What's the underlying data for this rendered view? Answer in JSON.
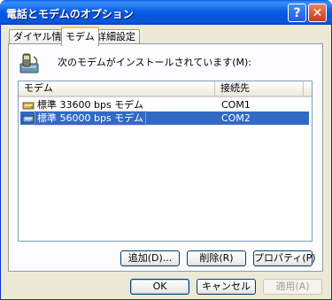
{
  "window": {
    "title": "電話とモデムのオプション",
    "help_glyph": "?",
    "close_glyph": "✕"
  },
  "tabs": [
    {
      "label": "ダイヤル情報",
      "active": false
    },
    {
      "label": "モデム",
      "active": true
    },
    {
      "label": "詳細設定",
      "active": false
    }
  ],
  "modem_tab": {
    "intro_label": "次のモデムがインストールされています(M):",
    "columns": [
      "モデム",
      "接続先"
    ],
    "rows": [
      {
        "name": "標準 33600 bps モデム",
        "port": "COM1",
        "selected": false
      },
      {
        "name": "標準 56000 bps モデム",
        "port": "COM2",
        "selected": true
      }
    ],
    "add_label": "追加(D)...",
    "remove_label": "削除(R)",
    "properties_label": "プロパティ(P)"
  },
  "footer": {
    "ok_label": "OK",
    "cancel_label": "キャンセル",
    "apply_label": "適用(A)"
  },
  "colors": {
    "titlebar": "#0a5fe8",
    "selection": "#316ac5",
    "tab_highlight": "#ffc83c"
  }
}
